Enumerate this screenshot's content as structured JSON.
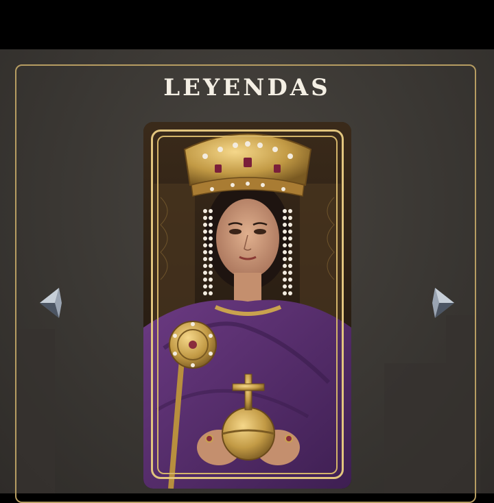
{
  "screen": {
    "title": "LEYENDAS"
  },
  "carousel": {
    "prev_icon": "chevron-left-gem-icon",
    "next_icon": "chevron-right-gem-icon",
    "card": {
      "portrait": "crowned-empress-portrait",
      "frame_color": "#e2c57e"
    }
  },
  "colors": {
    "frame_gold": "#b79d62",
    "robe_purple": "#5a2f6e",
    "background": "#3a3733"
  }
}
